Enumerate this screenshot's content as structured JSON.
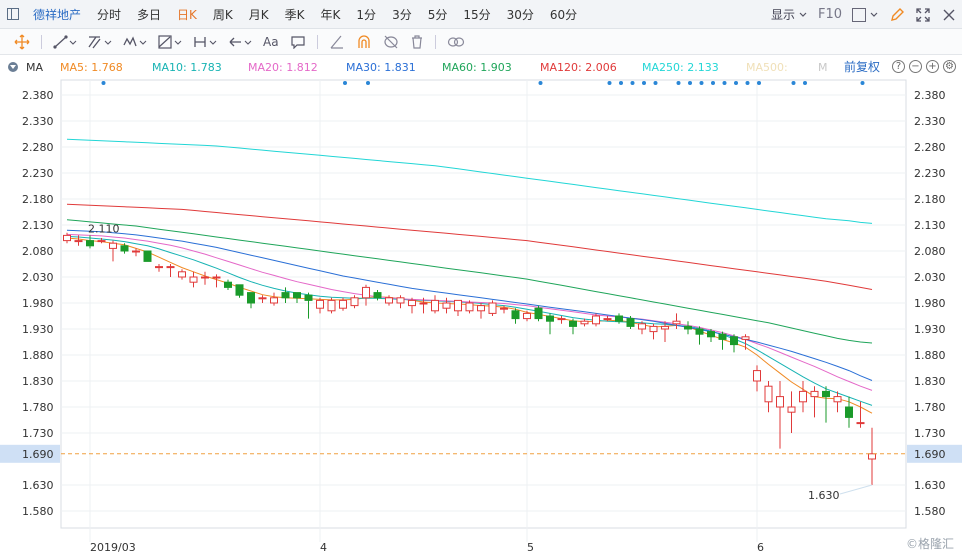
{
  "topbar": {
    "stock_name": "德祥地产",
    "periods": [
      "分时",
      "多日",
      "日K",
      "周K",
      "月K",
      "季K",
      "年K",
      "1分",
      "3分",
      "5分",
      "15分",
      "30分",
      "60分"
    ],
    "active_period": "日K",
    "display_label": "显示",
    "f10_label": "F10"
  },
  "toolbar": {
    "text_tool": "Aa"
  },
  "ma_bar": {
    "label": "MA",
    "restore_label": "前复权",
    "items": [
      {
        "text": "MA5: 1.768",
        "color": "#f08a24"
      },
      {
        "text": "MA10: 1.783",
        "color": "#17b3b3"
      },
      {
        "text": "MA20: 1.812",
        "color": "#e468c8"
      },
      {
        "text": "MA30: 1.831",
        "color": "#2a6fd6"
      },
      {
        "text": "MA60: 1.903",
        "color": "#1fa55a"
      },
      {
        "text": "MA120: 2.006",
        "color": "#e03a3a"
      },
      {
        "text": "MA250: 2.133",
        "color": "#22d6d6"
      },
      {
        "text": "MA500:",
        "color": "#f0e0b8"
      },
      {
        "text": "M",
        "color": "#c8c8c8"
      }
    ]
  },
  "chart_data": {
    "type": "candlestick",
    "ylim": [
      1.55,
      2.4
    ],
    "y_ticks": [
      "2.380",
      "2.330",
      "2.280",
      "2.230",
      "2.180",
      "2.130",
      "2.080",
      "2.030",
      "1.980",
      "1.930",
      "1.880",
      "1.830",
      "1.780",
      "1.730",
      "1.690",
      "1.630",
      "1.580"
    ],
    "y_tick_values": [
      2.38,
      2.33,
      2.28,
      2.23,
      2.18,
      2.13,
      2.08,
      2.03,
      1.98,
      1.93,
      1.88,
      1.83,
      1.78,
      1.73,
      1.69,
      1.63,
      1.58
    ],
    "x_labels": [
      {
        "text": "2019/03",
        "index": 2
      },
      {
        "text": "4",
        "index": 22
      },
      {
        "text": "5",
        "index": 40
      },
      {
        "text": "6",
        "index": 60
      }
    ],
    "current_price": "1.690",
    "current_price_value": 1.69,
    "annotations": [
      {
        "text": "2.110",
        "index": 2,
        "value": 2.11
      },
      {
        "text": "1.630",
        "index": 70,
        "value": 1.63
      }
    ],
    "event_dot_indices": [
      3,
      24,
      26,
      41,
      47,
      48,
      49,
      50,
      51,
      53,
      54,
      55,
      56,
      57,
      58,
      59,
      60,
      63,
      64,
      69
    ],
    "candles": [
      {
        "o": 2.1,
        "c": 2.11,
        "h": 2.115,
        "l": 2.095
      },
      {
        "o": 2.1,
        "c": 2.1,
        "h": 2.11,
        "l": 2.09
      },
      {
        "o": 2.1,
        "c": 2.09,
        "h": 2.11,
        "l": 2.085
      },
      {
        "o": 2.1,
        "c": 2.1,
        "h": 2.105,
        "l": 2.095
      },
      {
        "o": 2.085,
        "c": 2.095,
        "h": 2.1,
        "l": 2.06
      },
      {
        "o": 2.09,
        "c": 2.08,
        "h": 2.095,
        "l": 2.075
      },
      {
        "o": 2.08,
        "c": 2.08,
        "h": 2.085,
        "l": 2.07
      },
      {
        "o": 2.08,
        "c": 2.06,
        "h": 2.08,
        "l": 2.06
      },
      {
        "o": 2.05,
        "c": 2.05,
        "h": 2.055,
        "l": 2.04
      },
      {
        "o": 2.05,
        "c": 2.05,
        "h": 2.055,
        "l": 2.03
      },
      {
        "o": 2.03,
        "c": 2.04,
        "h": 2.045,
        "l": 2.025
      },
      {
        "o": 2.02,
        "c": 2.03,
        "h": 2.04,
        "l": 2.01
      },
      {
        "o": 2.03,
        "c": 2.03,
        "h": 2.04,
        "l": 2.015
      },
      {
        "o": 2.03,
        "c": 2.03,
        "h": 2.035,
        "l": 2.01
      },
      {
        "o": 2.02,
        "c": 2.01,
        "h": 2.025,
        "l": 2.005
      },
      {
        "o": 2.015,
        "c": 1.995,
        "h": 2.015,
        "l": 1.99
      },
      {
        "o": 2.0,
        "c": 1.98,
        "h": 2.0,
        "l": 1.97
      },
      {
        "o": 1.99,
        "c": 1.99,
        "h": 1.995,
        "l": 1.98
      },
      {
        "o": 1.98,
        "c": 1.99,
        "h": 2.0,
        "l": 1.975
      },
      {
        "o": 2.0,
        "c": 1.99,
        "h": 2.01,
        "l": 1.98
      },
      {
        "o": 2.0,
        "c": 1.99,
        "h": 2.0,
        "l": 1.98
      },
      {
        "o": 1.995,
        "c": 1.985,
        "h": 2.0,
        "l": 1.95
      },
      {
        "o": 1.97,
        "c": 1.985,
        "h": 1.99,
        "l": 1.96
      },
      {
        "o": 1.965,
        "c": 1.985,
        "h": 1.99,
        "l": 1.96
      },
      {
        "o": 1.97,
        "c": 1.985,
        "h": 1.99,
        "l": 1.965
      },
      {
        "o": 1.975,
        "c": 1.99,
        "h": 1.995,
        "l": 1.97
      },
      {
        "o": 1.99,
        "c": 2.01,
        "h": 2.015,
        "l": 1.975
      },
      {
        "o": 2.0,
        "c": 1.99,
        "h": 2.005,
        "l": 1.985
      },
      {
        "o": 1.98,
        "c": 1.99,
        "h": 1.995,
        "l": 1.975
      },
      {
        "o": 1.98,
        "c": 1.99,
        "h": 1.995,
        "l": 1.97
      },
      {
        "o": 1.975,
        "c": 1.985,
        "h": 1.99,
        "l": 1.96
      },
      {
        "o": 1.98,
        "c": 1.98,
        "h": 1.99,
        "l": 1.96
      },
      {
        "o": 1.965,
        "c": 1.985,
        "h": 1.995,
        "l": 1.96
      },
      {
        "o": 1.97,
        "c": 1.98,
        "h": 1.99,
        "l": 1.96
      },
      {
        "o": 1.965,
        "c": 1.985,
        "h": 1.985,
        "l": 1.955
      },
      {
        "o": 1.965,
        "c": 1.98,
        "h": 1.985,
        "l": 1.96
      },
      {
        "o": 1.965,
        "c": 1.975,
        "h": 1.98,
        "l": 1.95
      },
      {
        "o": 1.96,
        "c": 1.98,
        "h": 1.985,
        "l": 1.955
      },
      {
        "o": 1.97,
        "c": 1.97,
        "h": 1.975,
        "l": 1.96
      },
      {
        "o": 1.965,
        "c": 1.95,
        "h": 1.97,
        "l": 1.94
      },
      {
        "o": 1.95,
        "c": 1.96,
        "h": 1.965,
        "l": 1.945
      },
      {
        "o": 1.97,
        "c": 1.95,
        "h": 1.975,
        "l": 1.945
      },
      {
        "o": 1.955,
        "c": 1.945,
        "h": 1.96,
        "l": 1.92
      },
      {
        "o": 1.95,
        "c": 1.95,
        "h": 1.955,
        "l": 1.94
      },
      {
        "o": 1.945,
        "c": 1.935,
        "h": 1.95,
        "l": 1.92
      },
      {
        "o": 1.94,
        "c": 1.945,
        "h": 1.95,
        "l": 1.935
      },
      {
        "o": 1.94,
        "c": 1.955,
        "h": 1.96,
        "l": 1.935
      },
      {
        "o": 1.95,
        "c": 1.95,
        "h": 1.955,
        "l": 1.945
      },
      {
        "o": 1.955,
        "c": 1.945,
        "h": 1.96,
        "l": 1.94
      },
      {
        "o": 1.95,
        "c": 1.935,
        "h": 1.955,
        "l": 1.93
      },
      {
        "o": 1.93,
        "c": 1.94,
        "h": 1.945,
        "l": 1.92
      },
      {
        "o": 1.925,
        "c": 1.935,
        "h": 1.94,
        "l": 1.91
      },
      {
        "o": 1.93,
        "c": 1.935,
        "h": 1.945,
        "l": 1.905
      },
      {
        "o": 1.94,
        "c": 1.945,
        "h": 1.96,
        "l": 1.93
      },
      {
        "o": 1.935,
        "c": 1.93,
        "h": 1.945,
        "l": 1.92
      },
      {
        "o": 1.93,
        "c": 1.92,
        "h": 1.935,
        "l": 1.9
      },
      {
        "o": 1.925,
        "c": 1.915,
        "h": 1.93,
        "l": 1.905
      },
      {
        "o": 1.92,
        "c": 1.91,
        "h": 1.925,
        "l": 1.89
      },
      {
        "o": 1.915,
        "c": 1.9,
        "h": 1.92,
        "l": 1.885
      },
      {
        "o": 1.91,
        "c": 1.915,
        "h": 1.92,
        "l": 1.89
      },
      {
        "o": 1.83,
        "c": 1.85,
        "h": 1.86,
        "l": 1.81
      },
      {
        "o": 1.79,
        "c": 1.82,
        "h": 1.83,
        "l": 1.77
      },
      {
        "o": 1.78,
        "c": 1.8,
        "h": 1.83,
        "l": 1.7
      },
      {
        "o": 1.77,
        "c": 1.78,
        "h": 1.81,
        "l": 1.73
      },
      {
        "o": 1.79,
        "c": 1.81,
        "h": 1.83,
        "l": 1.77
      },
      {
        "o": 1.8,
        "c": 1.81,
        "h": 1.82,
        "l": 1.76
      },
      {
        "o": 1.81,
        "c": 1.8,
        "h": 1.82,
        "l": 1.75
      },
      {
        "o": 1.79,
        "c": 1.8,
        "h": 1.81,
        "l": 1.77
      },
      {
        "o": 1.78,
        "c": 1.76,
        "h": 1.8,
        "l": 1.74
      },
      {
        "o": 1.75,
        "c": 1.75,
        "h": 1.79,
        "l": 1.74
      },
      {
        "o": 1.68,
        "c": 1.69,
        "h": 1.74,
        "l": 1.63
      }
    ],
    "ma_series": [
      {
        "name": "MA5",
        "color": "#f08a24",
        "values": [
          2.105,
          2.103,
          2.1,
          2.098,
          2.095,
          2.092,
          2.085,
          2.078,
          2.068,
          2.058,
          2.048,
          2.04,
          2.032,
          2.025,
          2.018,
          2.01,
          2.003,
          1.996,
          1.992,
          1.99,
          1.989,
          1.988,
          1.987,
          1.986,
          1.986,
          1.987,
          1.99,
          1.992,
          1.991,
          1.988,
          1.985,
          1.982,
          1.98,
          1.979,
          1.978,
          1.977,
          1.975,
          1.974,
          1.972,
          1.968,
          1.962,
          1.958,
          1.954,
          1.95,
          1.946,
          1.944,
          1.945,
          1.946,
          1.947,
          1.943,
          1.938,
          1.934,
          1.935,
          1.937,
          1.934,
          1.926,
          1.918,
          1.91,
          1.903,
          1.895,
          1.88,
          1.862,
          1.845,
          1.828,
          1.814,
          1.8,
          1.797,
          1.796,
          1.79,
          1.78,
          1.768
        ]
      },
      {
        "name": "MA10",
        "color": "#17b3b3",
        "values": [
          2.108,
          2.107,
          2.105,
          2.103,
          2.101,
          2.098,
          2.094,
          2.09,
          2.084,
          2.077,
          2.07,
          2.063,
          2.055,
          2.047,
          2.038,
          2.029,
          2.021,
          2.014,
          2.008,
          2.003,
          1.999,
          1.996,
          1.993,
          1.991,
          1.99,
          1.989,
          1.989,
          1.989,
          1.988,
          1.987,
          1.986,
          1.985,
          1.984,
          1.983,
          1.982,
          1.981,
          1.979,
          1.977,
          1.975,
          1.972,
          1.968,
          1.964,
          1.96,
          1.956,
          1.952,
          1.949,
          1.947,
          1.945,
          1.944,
          1.943,
          1.942,
          1.94,
          1.939,
          1.937,
          1.935,
          1.931,
          1.926,
          1.919,
          1.911,
          1.902,
          1.89,
          1.877,
          1.864,
          1.851,
          1.838,
          1.826,
          1.815,
          1.807,
          1.799,
          1.791,
          1.783
        ]
      },
      {
        "name": "MA20",
        "color": "#e468c8",
        "values": [
          2.112,
          2.111,
          2.11,
          2.109,
          2.107,
          2.105,
          2.102,
          2.099,
          2.095,
          2.091,
          2.086,
          2.08,
          2.074,
          2.067,
          2.06,
          2.053,
          2.046,
          2.039,
          2.033,
          2.027,
          2.021,
          2.016,
          2.011,
          2.006,
          2.002,
          1.998,
          1.995,
          1.992,
          1.99,
          1.988,
          1.987,
          1.986,
          1.985,
          1.984,
          1.983,
          1.982,
          1.981,
          1.98,
          1.979,
          1.977,
          1.975,
          1.972,
          1.969,
          1.966,
          1.963,
          1.96,
          1.957,
          1.955,
          1.953,
          1.951,
          1.949,
          1.946,
          1.943,
          1.94,
          1.937,
          1.933,
          1.928,
          1.923,
          1.917,
          1.91,
          1.902,
          1.894,
          1.885,
          1.876,
          1.867,
          1.858,
          1.848,
          1.838,
          1.829,
          1.82,
          1.812
        ]
      },
      {
        "name": "MA30",
        "color": "#2a6fd6",
        "values": [
          2.12,
          2.119,
          2.118,
          2.117,
          2.115,
          2.113,
          2.111,
          2.108,
          2.105,
          2.102,
          2.099,
          2.095,
          2.091,
          2.087,
          2.082,
          2.077,
          2.072,
          2.067,
          2.062,
          2.057,
          2.052,
          2.047,
          2.042,
          2.037,
          2.032,
          2.028,
          2.024,
          2.02,
          2.016,
          2.012,
          2.008,
          2.005,
          2.002,
          1.999,
          1.996,
          1.993,
          1.99,
          1.987,
          1.984,
          1.981,
          1.978,
          1.975,
          1.972,
          1.969,
          1.966,
          1.963,
          1.96,
          1.957,
          1.954,
          1.951,
          1.948,
          1.945,
          1.941,
          1.937,
          1.933,
          1.929,
          1.925,
          1.92,
          1.915,
          1.91,
          1.905,
          1.899,
          1.893,
          1.887,
          1.88,
          1.873,
          1.866,
          1.858,
          1.85,
          1.84,
          1.831
        ]
      },
      {
        "name": "MA60",
        "color": "#1fa55a",
        "values": [
          2.14,
          2.138,
          2.136,
          2.134,
          2.132,
          2.13,
          2.128,
          2.125,
          2.122,
          2.119,
          2.116,
          2.113,
          2.11,
          2.107,
          2.104,
          2.101,
          2.098,
          2.095,
          2.092,
          2.089,
          2.086,
          2.083,
          2.08,
          2.077,
          2.074,
          2.071,
          2.068,
          2.065,
          2.062,
          2.059,
          2.056,
          2.053,
          2.05,
          2.047,
          2.044,
          2.041,
          2.038,
          2.035,
          2.032,
          2.029,
          2.026,
          2.022,
          2.018,
          2.014,
          2.01,
          2.006,
          2.002,
          1.998,
          1.994,
          1.99,
          1.986,
          1.982,
          1.978,
          1.974,
          1.97,
          1.966,
          1.962,
          1.958,
          1.954,
          1.95,
          1.946,
          1.942,
          1.937,
          1.932,
          1.927,
          1.922,
          1.917,
          1.912,
          1.908,
          1.905,
          1.903
        ]
      },
      {
        "name": "MA120",
        "color": "#e03a3a",
        "values": [
          2.17,
          2.169,
          2.168,
          2.167,
          2.166,
          2.165,
          2.164,
          2.163,
          2.162,
          2.161,
          2.16,
          2.158,
          2.156,
          2.154,
          2.152,
          2.15,
          2.148,
          2.146,
          2.144,
          2.142,
          2.14,
          2.138,
          2.136,
          2.134,
          2.132,
          2.13,
          2.128,
          2.126,
          2.124,
          2.122,
          2.12,
          2.118,
          2.116,
          2.114,
          2.112,
          2.11,
          2.108,
          2.106,
          2.104,
          2.102,
          2.1,
          2.097,
          2.094,
          2.091,
          2.088,
          2.085,
          2.082,
          2.079,
          2.076,
          2.073,
          2.07,
          2.067,
          2.064,
          2.061,
          2.058,
          2.055,
          2.052,
          2.049,
          2.046,
          2.043,
          2.04,
          2.037,
          2.034,
          2.031,
          2.028,
          2.025,
          2.022,
          2.018,
          2.014,
          2.01,
          2.006
        ]
      },
      {
        "name": "MA250",
        "color": "#22d6d6",
        "values": [
          2.295,
          2.294,
          2.293,
          2.292,
          2.291,
          2.29,
          2.289,
          2.288,
          2.287,
          2.286,
          2.285,
          2.284,
          2.283,
          2.282,
          2.28,
          2.278,
          2.276,
          2.274,
          2.272,
          2.27,
          2.268,
          2.266,
          2.264,
          2.262,
          2.26,
          2.258,
          2.256,
          2.254,
          2.252,
          2.25,
          2.248,
          2.246,
          2.244,
          2.241,
          2.238,
          2.235,
          2.232,
          2.229,
          2.226,
          2.223,
          2.22,
          2.217,
          2.214,
          2.211,
          2.208,
          2.205,
          2.202,
          2.199,
          2.196,
          2.193,
          2.19,
          2.187,
          2.184,
          2.181,
          2.178,
          2.175,
          2.172,
          2.169,
          2.166,
          2.163,
          2.16,
          2.157,
          2.154,
          2.151,
          2.148,
          2.145,
          2.142,
          2.14,
          2.138,
          2.135,
          2.133
        ]
      }
    ]
  },
  "watermark": "©格隆汇"
}
